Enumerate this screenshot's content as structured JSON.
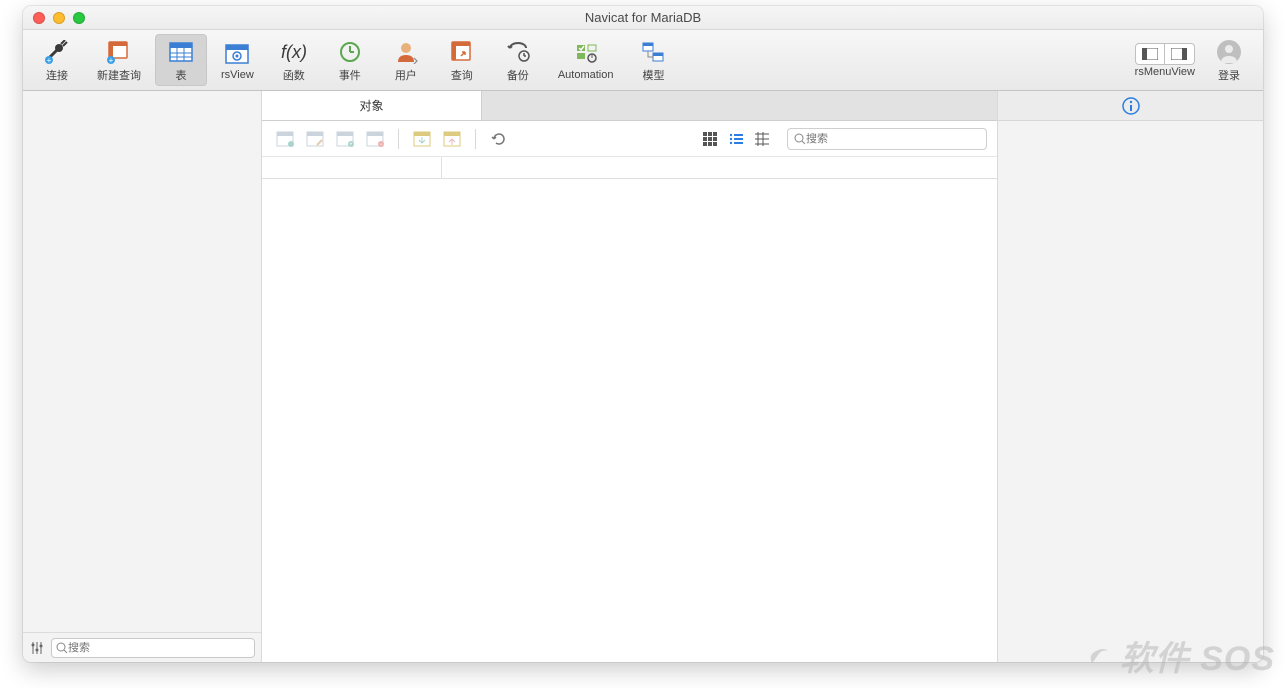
{
  "window": {
    "title": "Navicat for MariaDB"
  },
  "toolbar": {
    "items": [
      {
        "id": "connection",
        "label": "连接"
      },
      {
        "id": "newquery",
        "label": "新建查询"
      },
      {
        "id": "table",
        "label": "表"
      },
      {
        "id": "rsview",
        "label": "rsView"
      },
      {
        "id": "function",
        "label": "函数"
      },
      {
        "id": "event",
        "label": "事件"
      },
      {
        "id": "user",
        "label": "用户"
      },
      {
        "id": "query",
        "label": "查询"
      },
      {
        "id": "backup",
        "label": "备份"
      },
      {
        "id": "automation",
        "label": "Automation"
      },
      {
        "id": "model",
        "label": "模型"
      }
    ],
    "menuview_label": "rsMenuView",
    "login_label": "登录"
  },
  "tabs": {
    "active_label": "对象"
  },
  "search": {
    "placeholder": "搜索"
  },
  "sidebar_search": {
    "placeholder": "搜索"
  },
  "watermark": "软件 SOS"
}
